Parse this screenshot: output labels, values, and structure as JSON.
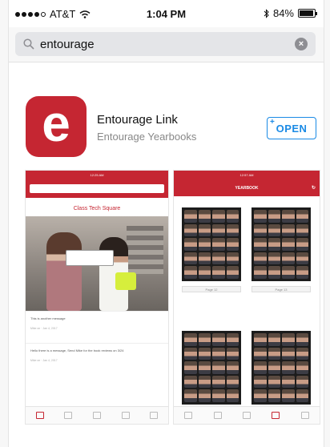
{
  "status_bar": {
    "carrier": "AT&T",
    "time": "1:04 PM",
    "battery": "84%",
    "battery_level": 0.84
  },
  "search": {
    "query": "entourage",
    "search_icon": "magnifier-icon",
    "clear_icon": "clear-x-icon"
  },
  "app": {
    "icon_letter": "e",
    "name": "Entourage Link",
    "developer": "Entourage Yearbooks",
    "open_label": "OPEN",
    "plus": "+",
    "brand_color": "#c52632",
    "accent_color": "#1a8ae5"
  },
  "screenshots": {
    "shot1": {
      "status_time": "12:25 AM",
      "title": "Class Tech Square",
      "messages": [
        {
          "text": "This is another message",
          "meta": "Mike on · Jan 4, 2017"
        },
        {
          "text": "Hello there is a message, Send Mike for the book reviews on 3/24",
          "meta": "Mike on · Jan 4, 2017"
        }
      ]
    },
    "shot2": {
      "status_time": "12:57 AM",
      "title": "YEARBOOK",
      "page_labels": [
        "Page 12",
        "Page 13"
      ]
    }
  }
}
